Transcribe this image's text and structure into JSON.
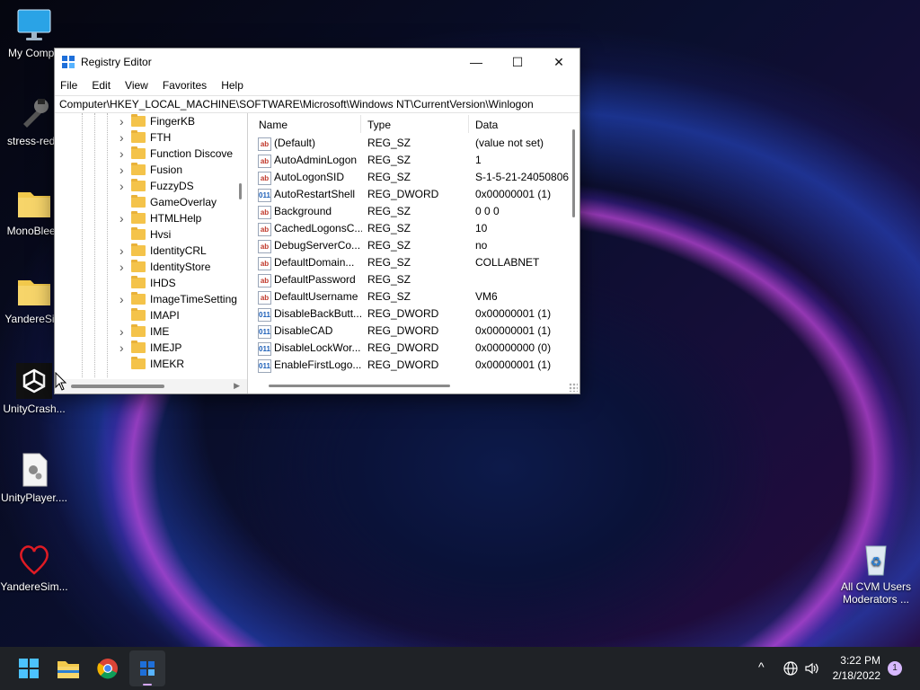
{
  "desktop": {
    "icons": [
      {
        "label": "My Compu",
        "icon": "monitor-icon"
      },
      {
        "label": "stress-redu",
        "icon": "tool-icon"
      },
      {
        "label": "MonoBleed",
        "icon": "folder-icon"
      },
      {
        "label": "YandereSim",
        "icon": "folder-icon"
      },
      {
        "label": "UnityCrash...",
        "icon": "unity-icon"
      },
      {
        "label": "UnityPlayer....",
        "icon": "settings-file-icon"
      },
      {
        "label": "YandereSim...",
        "icon": "heart-icon"
      }
    ],
    "recycle": {
      "line1": "All CVM Users",
      "line2": "Moderators ..."
    }
  },
  "window": {
    "title": "Registry Editor",
    "controls": {
      "minimize": "—",
      "maximize": "☐",
      "close": "✕"
    },
    "menu": [
      "File",
      "Edit",
      "View",
      "Favorites",
      "Help"
    ],
    "address": "Computer\\HKEY_LOCAL_MACHINE\\SOFTWARE\\Microsoft\\Windows NT\\CurrentVersion\\Winlogon",
    "tree": [
      {
        "name": "FingerKB",
        "expandable": true
      },
      {
        "name": "FTH",
        "expandable": true
      },
      {
        "name": "Function Discove",
        "expandable": true
      },
      {
        "name": "Fusion",
        "expandable": true
      },
      {
        "name": "FuzzyDS",
        "expandable": true
      },
      {
        "name": "GameOverlay",
        "expandable": false
      },
      {
        "name": "HTMLHelp",
        "expandable": true
      },
      {
        "name": "Hvsi",
        "expandable": false
      },
      {
        "name": "IdentityCRL",
        "expandable": true
      },
      {
        "name": "IdentityStore",
        "expandable": true
      },
      {
        "name": "IHDS",
        "expandable": false
      },
      {
        "name": "ImageTimeSetting",
        "expandable": true
      },
      {
        "name": "IMAPI",
        "expandable": false
      },
      {
        "name": "IME",
        "expandable": true
      },
      {
        "name": "IMEJP",
        "expandable": true
      },
      {
        "name": "IMEKR",
        "expandable": false
      }
    ],
    "columns": {
      "name": "Name",
      "type": "Type",
      "data": "Data"
    },
    "values": [
      {
        "name": "(Default)",
        "type": "REG_SZ",
        "data": "(value not set)",
        "kind": "sz"
      },
      {
        "name": "AutoAdminLogon",
        "type": "REG_SZ",
        "data": "1",
        "kind": "sz"
      },
      {
        "name": "AutoLogonSID",
        "type": "REG_SZ",
        "data": "S-1-5-21-24050806",
        "kind": "sz"
      },
      {
        "name": "AutoRestartShell",
        "type": "REG_DWORD",
        "data": "0x00000001 (1)",
        "kind": "dw"
      },
      {
        "name": "Background",
        "type": "REG_SZ",
        "data": "0 0 0",
        "kind": "sz"
      },
      {
        "name": "CachedLogonsC...",
        "type": "REG_SZ",
        "data": "10",
        "kind": "sz"
      },
      {
        "name": "DebugServerCo...",
        "type": "REG_SZ",
        "data": "no",
        "kind": "sz"
      },
      {
        "name": "DefaultDomain...",
        "type": "REG_SZ",
        "data": "COLLABNET",
        "kind": "sz"
      },
      {
        "name": "DefaultPassword",
        "type": "REG_SZ",
        "data": "",
        "kind": "sz"
      },
      {
        "name": "DefaultUsername",
        "type": "REG_SZ",
        "data": "VM6",
        "kind": "sz"
      },
      {
        "name": "DisableBackButt...",
        "type": "REG_DWORD",
        "data": "0x00000001 (1)",
        "kind": "dw"
      },
      {
        "name": "DisableCAD",
        "type": "REG_DWORD",
        "data": "0x00000001 (1)",
        "kind": "dw"
      },
      {
        "name": "DisableLockWor...",
        "type": "REG_DWORD",
        "data": "0x00000000 (0)",
        "kind": "dw"
      },
      {
        "name": "EnableFirstLogo...",
        "type": "REG_DWORD",
        "data": "0x00000001 (1)",
        "kind": "dw"
      }
    ],
    "icon_text": {
      "sz": "ab",
      "dw": "011"
    }
  },
  "taskbar": {
    "apps": [
      "start-icon",
      "file-explorer-icon",
      "chrome-icon",
      "registry-editor-icon"
    ],
    "tray": {
      "chevron": "^",
      "time": "3:22 PM",
      "date": "2/18/2022",
      "notifications": "1"
    }
  }
}
